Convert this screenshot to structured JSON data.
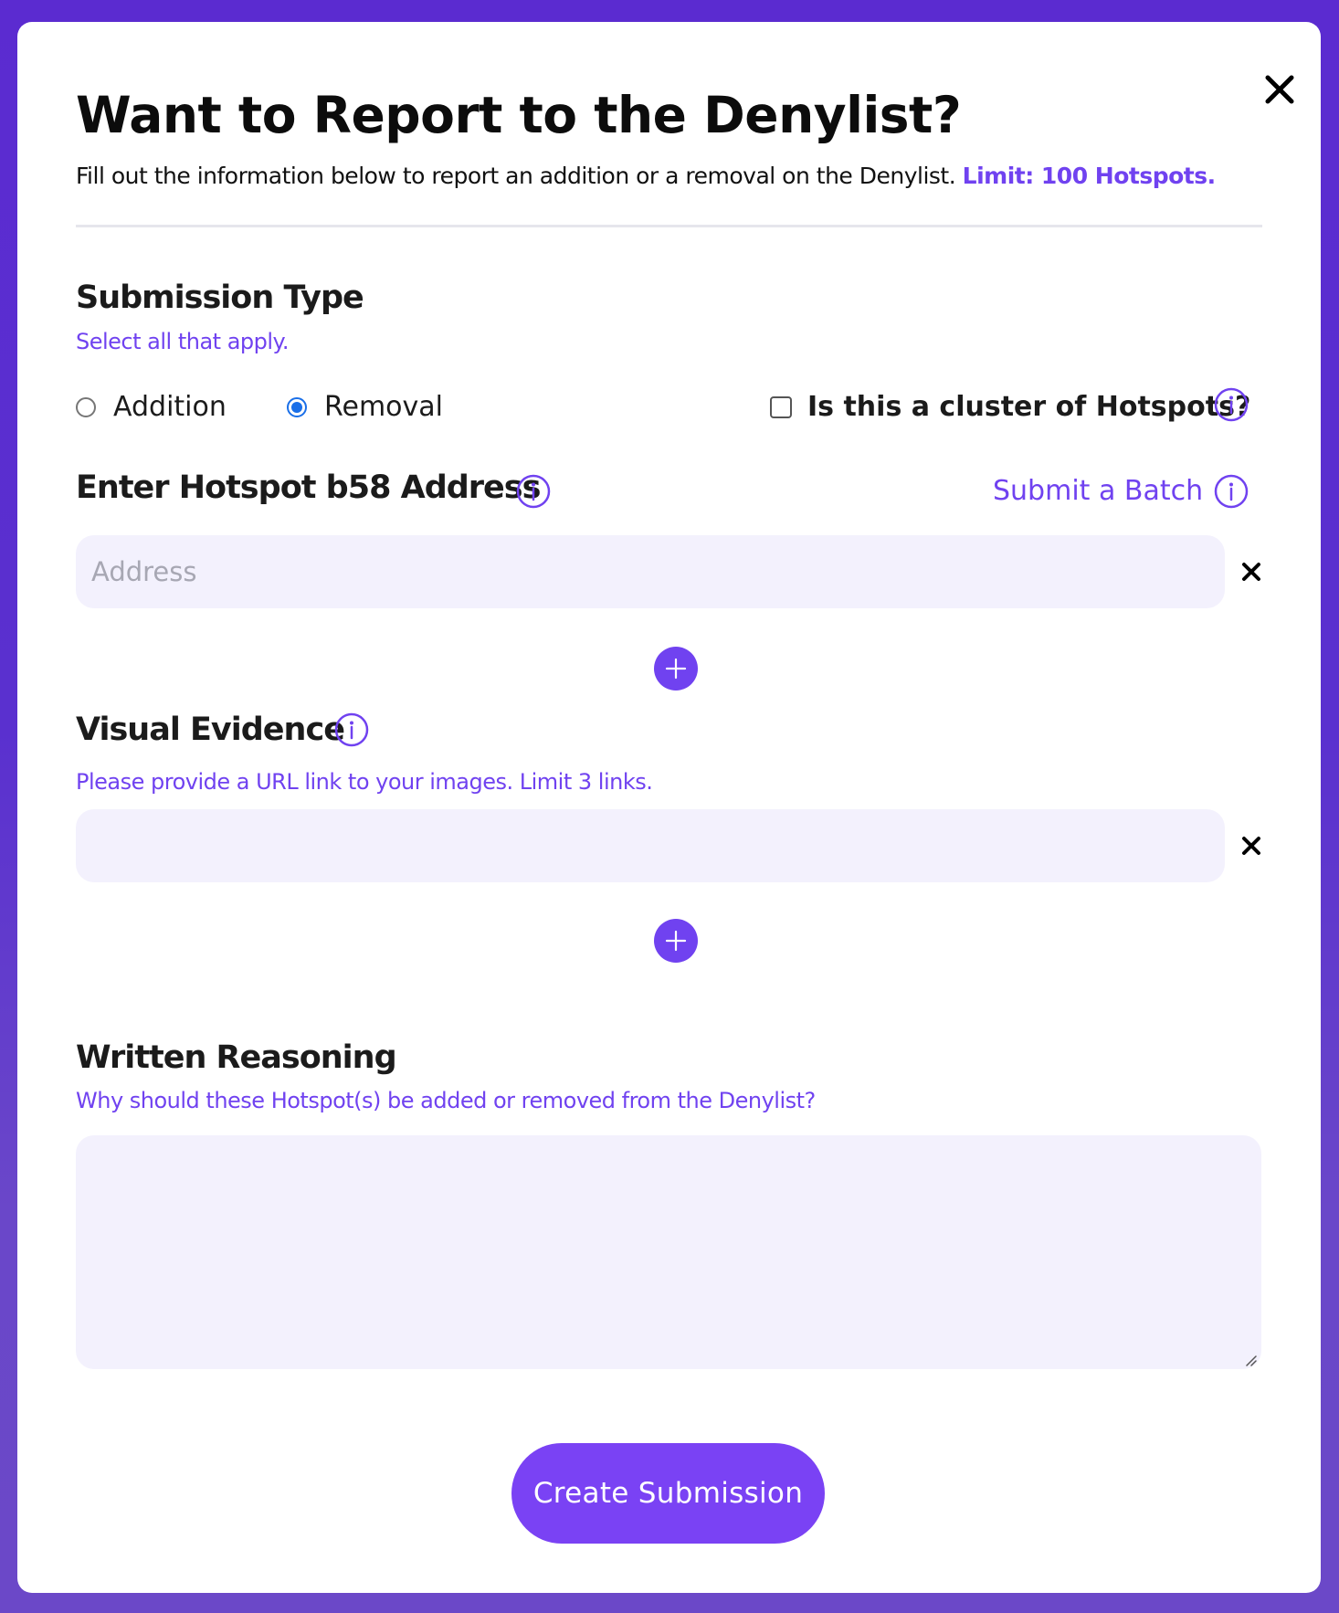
{
  "modal": {
    "title": "Want to Report to the Denylist?",
    "subtitle": "Fill out the information below to report an addition or a removal on the Denylist.",
    "limit_text": "Limit: 100 Hotspots."
  },
  "submission_type": {
    "title": "Submission Type",
    "hint": "Select all that apply.",
    "options": [
      {
        "label": "Addition",
        "checked": false
      },
      {
        "label": "Removal",
        "checked": true
      }
    ],
    "cluster_label": "Is this a cluster of Hotspots?",
    "cluster_checked": false
  },
  "address": {
    "title": "Enter Hotspot b58 Address",
    "batch_link": "Submit a Batch",
    "placeholder": "Address",
    "value": ""
  },
  "evidence": {
    "title": "Visual Evidence",
    "hint": "Please provide a URL link to your images. Limit 3 links.",
    "value": ""
  },
  "reasoning": {
    "title": "Written Reasoning",
    "hint": "Why should these Hotspot(s) be added or removed from the Denylist?",
    "value": ""
  },
  "submit_label": "Create Submission",
  "colors": {
    "accent": "#7042f0",
    "input_bg": "#f3f1fd",
    "frame_bg": "#5b2bd0",
    "radio_checked": "#1a6fe8"
  },
  "icons": {
    "close": "close-icon",
    "info": "info-icon",
    "remove": "x-icon",
    "add": "plus-icon"
  }
}
